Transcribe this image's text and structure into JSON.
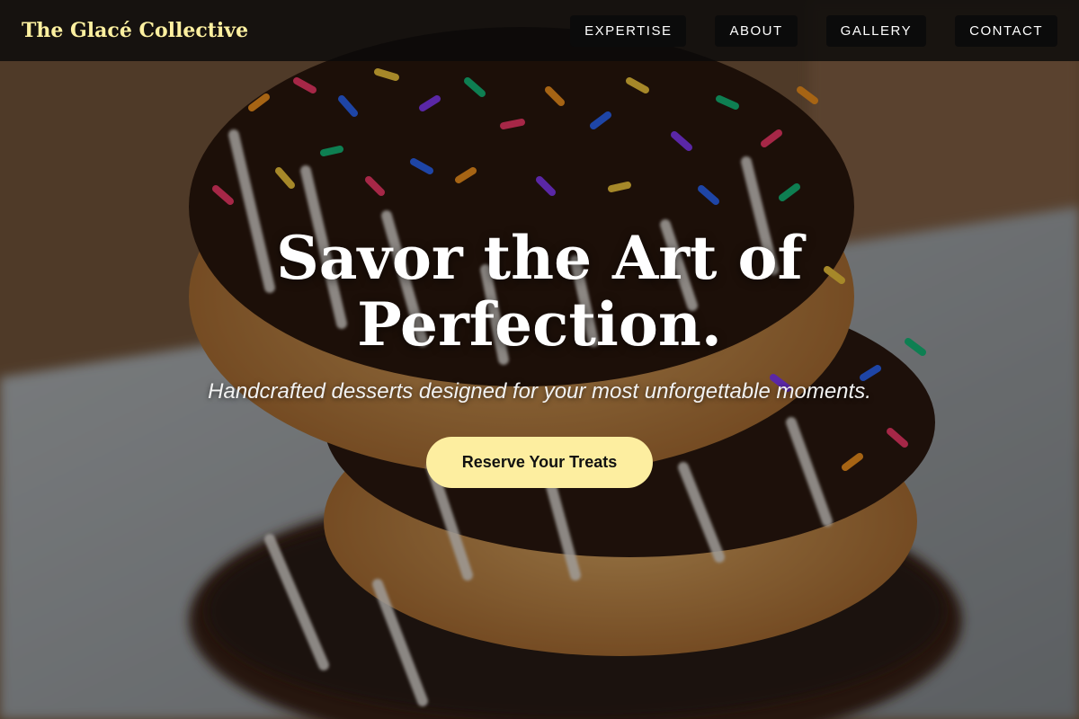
{
  "brand": {
    "name": "The Glacé Collective",
    "color": "#fdf0a0"
  },
  "nav": {
    "items": [
      {
        "label": "EXPERTISE"
      },
      {
        "label": "ABOUT"
      },
      {
        "label": "GALLERY"
      },
      {
        "label": "CONTACT"
      }
    ]
  },
  "hero": {
    "headline": "Savor the Art of Perfection.",
    "subheadline": "Handcrafted desserts designed for your most unforgettable moments.",
    "cta_label": "Reserve Your Treats",
    "cta_color": "#fdeea0",
    "background_image": "stacked chocolate-glazed donuts with rainbow sprinkles"
  }
}
